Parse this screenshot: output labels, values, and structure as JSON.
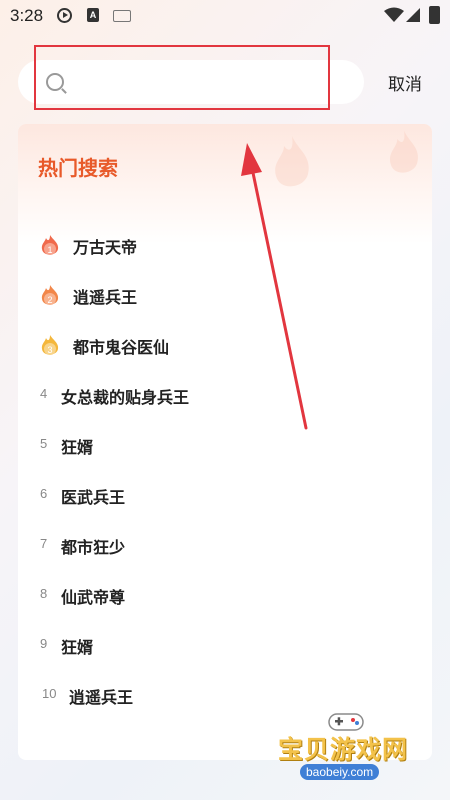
{
  "status_bar": {
    "time": "3:28",
    "icons": [
      "play-icon",
      "a-icon",
      "keyboard-icon",
      "wifi-icon",
      "signal-icon",
      "battery-icon"
    ]
  },
  "search": {
    "placeholder": "",
    "value": "",
    "cancel_label": "取消"
  },
  "hot_search": {
    "title": "热门搜索",
    "items": [
      {
        "rank": "1",
        "label": "万古天帝",
        "badge_color": "#f06a4c"
      },
      {
        "rank": "2",
        "label": "逍遥兵王",
        "badge_color": "#f2874a"
      },
      {
        "rank": "3",
        "label": "都市鬼谷医仙",
        "badge_color": "#f4b73c"
      },
      {
        "rank": "4",
        "label": "女总裁的贴身兵王"
      },
      {
        "rank": "5",
        "label": "狂婿"
      },
      {
        "rank": "6",
        "label": "医武兵王"
      },
      {
        "rank": "7",
        "label": "都市狂少"
      },
      {
        "rank": "8",
        "label": "仙武帝尊"
      },
      {
        "rank": "9",
        "label": "狂婿"
      },
      {
        "rank": "10",
        "label": "逍遥兵王"
      }
    ]
  },
  "watermark": {
    "title": "宝贝游戏网",
    "url": "baobeiy.com"
  },
  "colors": {
    "accent": "#e85a2a",
    "annotation": "#e2363f"
  }
}
